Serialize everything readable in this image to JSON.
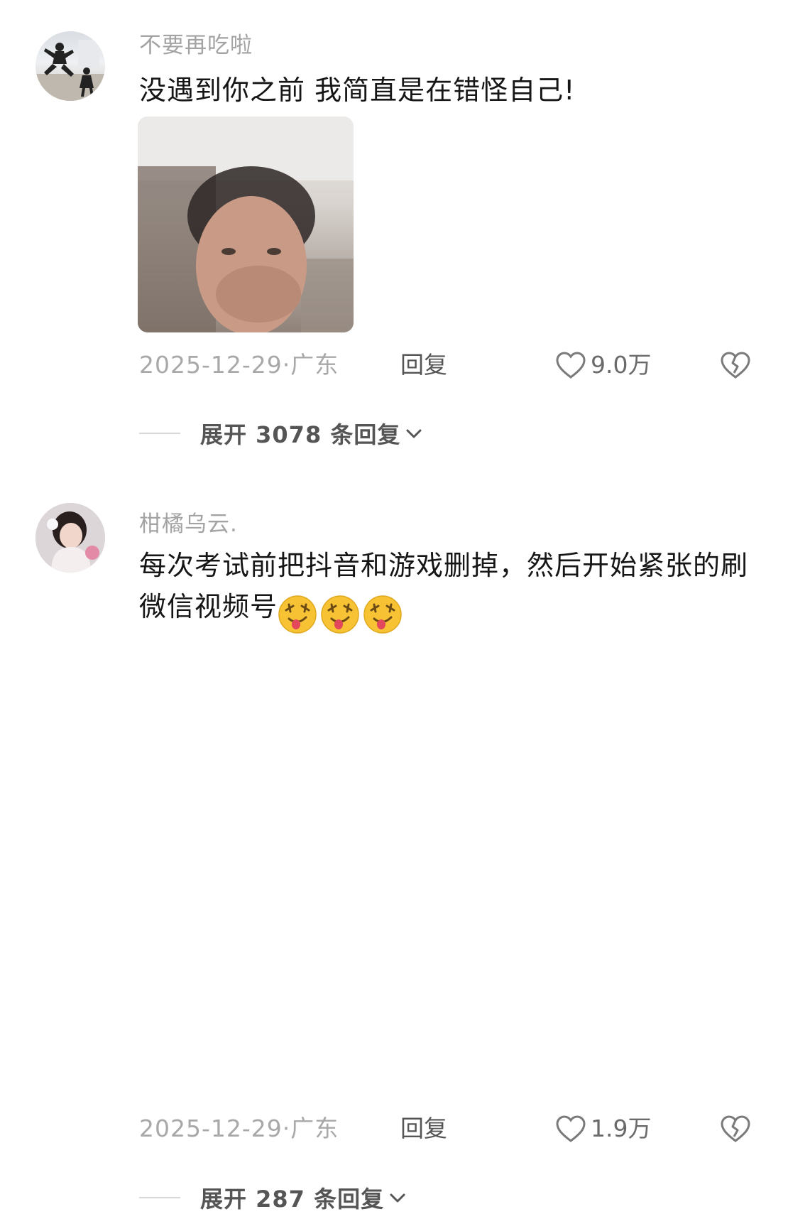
{
  "comments": [
    {
      "username": "不要再吃啦",
      "text": "没遇到你之前 我简直是在错怪自己!",
      "has_image": true,
      "date_location": "2025-12-29·广东",
      "reply_label": "回复",
      "like_count": "9.0万",
      "expand_label": "展开 3078 条回复"
    },
    {
      "username": "柑橘乌云.",
      "text": "每次考试前把抖音和游戏删掉，然后开始紧张的刷微信视频号",
      "emojis": [
        "drooling-face-emoji",
        "drooling-face-emoji",
        "drooling-face-emoji"
      ],
      "date_location": "2025-12-29·广东",
      "reply_label": "回复",
      "like_count": "1.9万",
      "expand_label": "展开 287 条回复"
    }
  ],
  "icons": {
    "like": "heart-outline-icon",
    "dislike": "broken-heart-icon",
    "expand": "chevron-down-icon"
  },
  "colors": {
    "username": "#a3a3a3",
    "text": "#161616",
    "meta": "#a8a8a8",
    "icon": "#7a7a7a"
  }
}
